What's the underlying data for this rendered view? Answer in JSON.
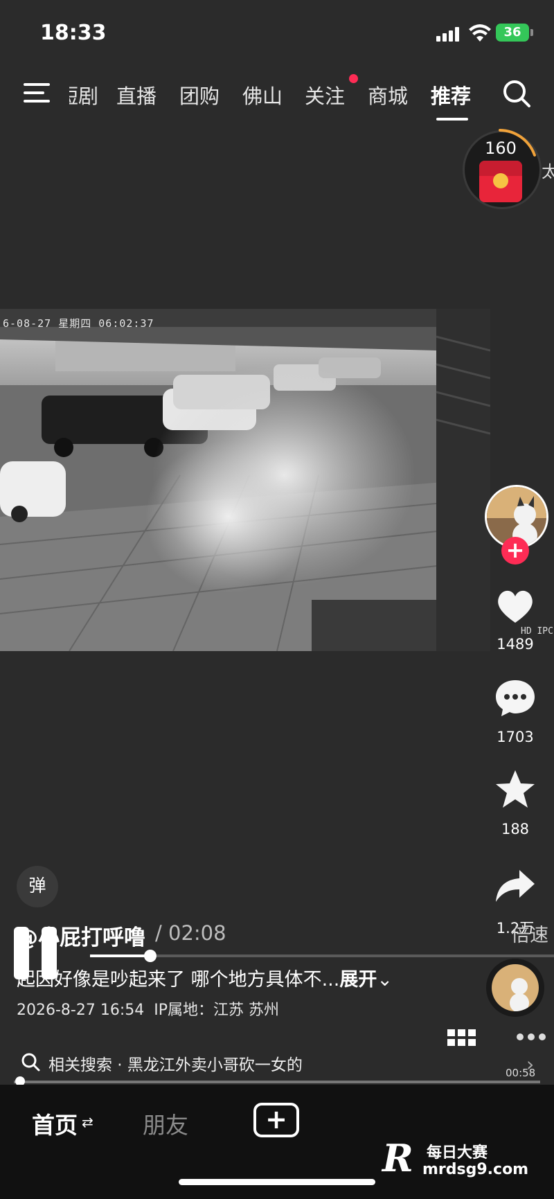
{
  "status_bar": {
    "time": "18:33",
    "battery": "36"
  },
  "top_nav": {
    "items": [
      "短剧",
      "直播",
      "团购",
      "佛山",
      "关注",
      "商城",
      "推荐"
    ],
    "active": "推荐"
  },
  "coin_widget": {
    "count": "160",
    "side_text": "太"
  },
  "video": {
    "overlay_text": "6-08-27 星期四 06:02:37",
    "brand_text": "HD IPC"
  },
  "right_rail": {
    "likes": "1489",
    "comments": "1703",
    "favorites": "188",
    "shares": "1.2万",
    "speed_label": "倍速"
  },
  "danmaku_label": "弹",
  "post": {
    "author": "@小屁打呼噜",
    "duration": "/ 02:08",
    "progress": 0.13,
    "caption": "起因好像是吵起来了 哪个地方具体不...",
    "expand": "展开",
    "datetime": "2026-8-27 16:54",
    "ip_location": "IP属地：江苏 苏州"
  },
  "related_search": {
    "text": "相关搜索 · 黑龙江外卖小哥砍一女的",
    "mini_time": "00:58"
  },
  "tab_bar": {
    "home": "首页",
    "friends": "朋友"
  },
  "watermark": {
    "title": "每日大赛",
    "site": "mrdsg9.com"
  },
  "colors": {
    "accent": "#fe2c55",
    "battery": "#34c759",
    "background": "#2b2b2b"
  }
}
